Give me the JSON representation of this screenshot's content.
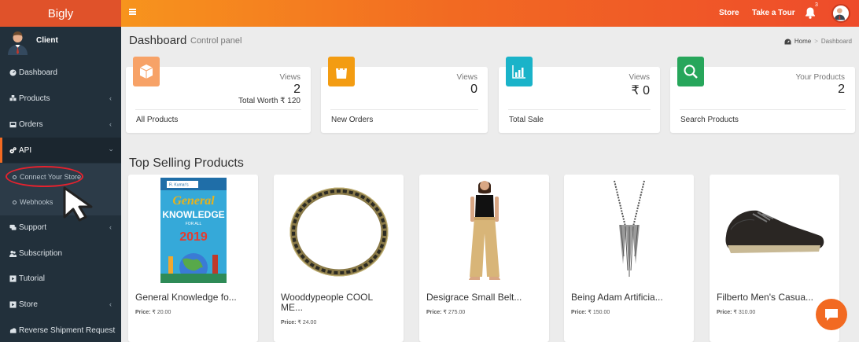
{
  "app": {
    "title": "Bigly"
  },
  "topbar": {
    "store": "Store",
    "tour": "Take a Tour",
    "notif_count": "3"
  },
  "sidebar": {
    "user": "Client",
    "items": [
      {
        "label": "Dashboard"
      },
      {
        "label": "Products"
      },
      {
        "label": "Orders"
      },
      {
        "label": "API"
      },
      {
        "label": "Support"
      },
      {
        "label": "Subscription"
      },
      {
        "label": "Tutorial"
      },
      {
        "label": "Store"
      },
      {
        "label": "Reverse Shipment Request"
      }
    ],
    "api_sub": [
      {
        "label": "Connect Your Store"
      },
      {
        "label": "Webhooks"
      }
    ]
  },
  "header": {
    "title": "Dashboard",
    "subtitle": "Control panel",
    "breadcrumb_home": "Home",
    "breadcrumb_current": "Dashboard"
  },
  "cards": [
    {
      "label": "Views",
      "value": "2",
      "extra": "Total Worth ₹ 120",
      "footer": "All Products",
      "color": "#f7a267"
    },
    {
      "label": "Views",
      "value": "0",
      "footer": "New Orders",
      "color": "#f39c12"
    },
    {
      "label": "Views",
      "value": "₹ 0",
      "footer": "Total Sale",
      "color": "#1ab3c9"
    },
    {
      "label": "Your Products",
      "value": "2",
      "footer": "Search Products",
      "color": "#27a65b"
    }
  ],
  "section": {
    "title": "Top Selling Products"
  },
  "products": [
    {
      "name": "General Knowledge fo...",
      "price_label": "Price:",
      "price": "₹ 20.00"
    },
    {
      "name": "Wooddypeople COOL ME...",
      "price_label": "Price:",
      "price": "₹ 24.00"
    },
    {
      "name": "Desigrace Small Belt...",
      "price_label": "Price:",
      "price": "₹ 275.00"
    },
    {
      "name": "Being Adam Artificia...",
      "price_label": "Price:",
      "price": "₹ 150.00"
    },
    {
      "name": "Filberto Men's Casua...",
      "price_label": "Price:",
      "price": "₹ 310.00"
    }
  ],
  "book": {
    "top_label": "R. Kumar's",
    "line1": "General",
    "line2": "KNOWLEDGE",
    "line3": "FOR ALL",
    "year": "2019"
  }
}
